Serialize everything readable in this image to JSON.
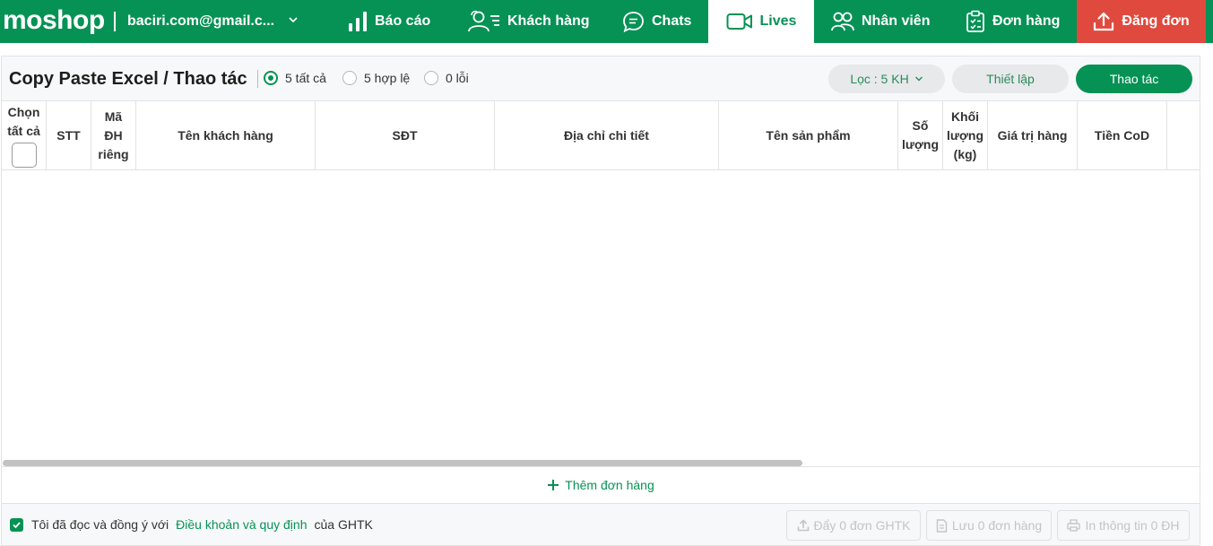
{
  "brand": {
    "logo": "moshop",
    "account": "baciri.com@gmail.c..."
  },
  "nav": {
    "items": [
      {
        "label": "Báo cáo",
        "icon": "bar-chart-icon"
      },
      {
        "label": "Khách hàng",
        "icon": "customers-icon"
      },
      {
        "label": "Chats",
        "icon": "chat-bubble-icon"
      },
      {
        "label": "Lives",
        "icon": "video-camera-icon",
        "active": true
      },
      {
        "label": "Nhân viên",
        "icon": "staff-icon"
      },
      {
        "label": "Đơn hàng",
        "icon": "clipboard-icon"
      }
    ],
    "publish": {
      "label": "Đăng đơn",
      "icon": "upload-icon"
    }
  },
  "panel": {
    "title": "Copy Paste Excel / Thao tác",
    "filters": [
      {
        "label": "5 tất cả",
        "selected": true
      },
      {
        "label": "5 hợp lệ",
        "selected": false
      },
      {
        "label": "0 lỗi",
        "selected": false
      }
    ],
    "filter_dropdown": "Lọc : 5 KH",
    "settings_button": "Thiết lập",
    "action_button": "Thao tác"
  },
  "table": {
    "columns": [
      {
        "line1": "Chọn",
        "line2": "tất cả"
      },
      {
        "line1": "STT"
      },
      {
        "line1": "Mã",
        "line2": "ĐH",
        "line3": "riêng"
      },
      {
        "line1": "Tên khách hàng"
      },
      {
        "line1": "SĐT"
      },
      {
        "line1": "Địa chỉ chi tiết"
      },
      {
        "line1": "Tên sản phẩm"
      },
      {
        "line1": "Số",
        "line2": "lượng"
      },
      {
        "line1": "Khối",
        "line2": "lượng",
        "line3": "(kg)"
      },
      {
        "line1": "Giá trị hàng"
      },
      {
        "line1": "Tiền CoD"
      }
    ],
    "rows": [],
    "add_row_label": "Thêm đơn hàng"
  },
  "footer": {
    "agree_prefix": "Tôi đã đọc và đồng ý với",
    "agree_link": "Điều khoản và quy định",
    "agree_suffix": "của GHTK",
    "agree_checked": true,
    "push_button": "Đẩy 0 đơn GHTK",
    "save_button": "Lưu 0 đơn hàng",
    "print_button": "In thông tin 0 ĐH"
  },
  "colors": {
    "brand_green": "#069255",
    "publish_red": "#e0493e",
    "disabled_text": "#c4c4c4"
  }
}
